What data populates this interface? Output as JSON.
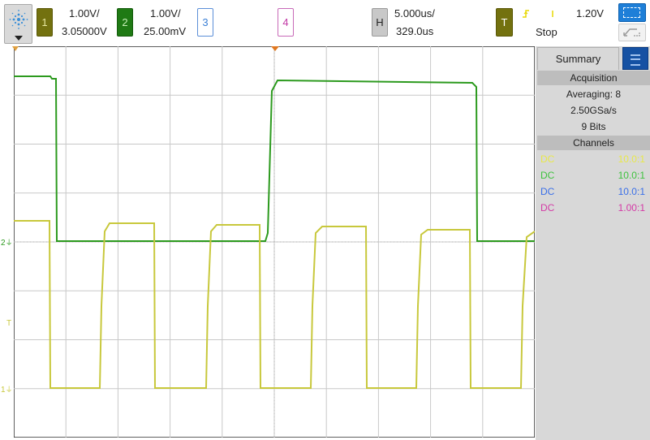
{
  "toolbar": {
    "ch1": {
      "number": "1",
      "scale": "1.00V/",
      "offset": "3.05000V",
      "color": "#c8c83c"
    },
    "ch2": {
      "number": "2",
      "scale": "1.00V/",
      "offset": "25.00mV",
      "color": "#2c9a1e"
    },
    "ch3": {
      "number": "3",
      "color": "#3a7fd5"
    },
    "ch4": {
      "number": "4",
      "color": "#c23aa6"
    },
    "horizontal": {
      "label": "H",
      "scale": "5.000us/",
      "delay": "329.0us"
    },
    "trigger": {
      "label": "T",
      "level": "1.20V",
      "state": "Stop"
    }
  },
  "panel": {
    "summary_tab": "Summary",
    "acquisition": {
      "heading": "Acquisition",
      "mode": "Averaging: 8",
      "rate": "2.50GSa/s",
      "bits": "9 Bits"
    },
    "channels": {
      "heading": "Channels",
      "rows": [
        {
          "coupling": "DC",
          "probe": "10.0:1",
          "color": "#e8e84a"
        },
        {
          "coupling": "DC",
          "probe": "10.0:1",
          "color": "#3ec23e"
        },
        {
          "coupling": "DC",
          "probe": "10.0:1",
          "color": "#3a6fe8"
        },
        {
          "coupling": "DC",
          "probe": "1.00:1",
          "color": "#d43aa6"
        }
      ]
    }
  },
  "markers": {
    "ch2_ground": "2",
    "trigger_level": "T",
    "ch1_ground": "1"
  }
}
